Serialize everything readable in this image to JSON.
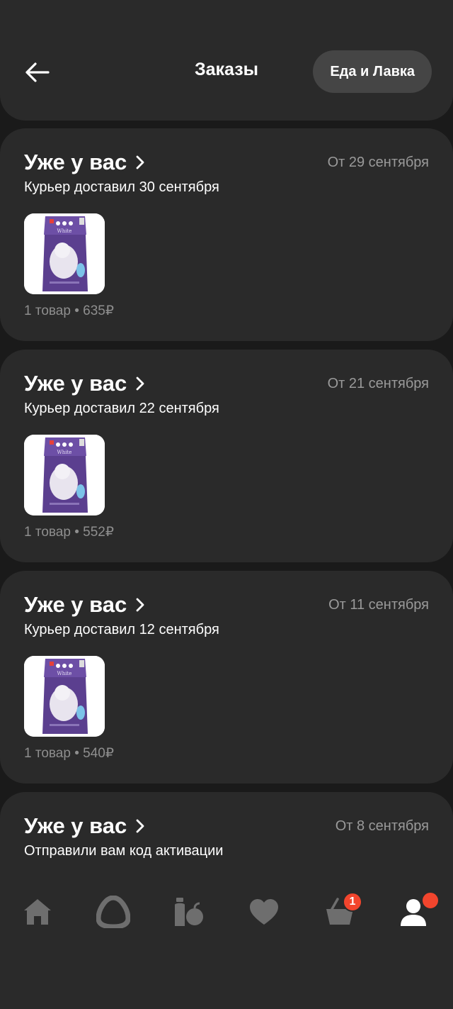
{
  "header": {
    "title": "Заказы",
    "switch_label": "Еда и Лавка"
  },
  "orders": [
    {
      "status": "Уже у вас",
      "date": "От 29 сентября",
      "subtitle": "Курьер доставил 30 сентября",
      "summary": "1 товар • 635₽"
    },
    {
      "status": "Уже у вас",
      "date": "От 21 сентября",
      "subtitle": "Курьер доставил 22 сентября",
      "summary": "1 товар • 552₽"
    },
    {
      "status": "Уже у вас",
      "date": "От 11 сентября",
      "subtitle": "Курьер доставил 12 сентября",
      "summary": "1 товар • 540₽"
    },
    {
      "status": "Уже у вас",
      "date": "От 8 сентября",
      "subtitle": "Отправили вам код активации"
    }
  ],
  "nav": {
    "items": [
      "home-icon",
      "alice-icon",
      "catalog-icon",
      "favorites-icon",
      "cart-icon",
      "profile-icon"
    ],
    "cart_badge": "1"
  },
  "colors": {
    "background": "#1a1a1a",
    "card": "#2a2a2a",
    "accent": "#f2452d",
    "muted": "#9a9a9a"
  }
}
